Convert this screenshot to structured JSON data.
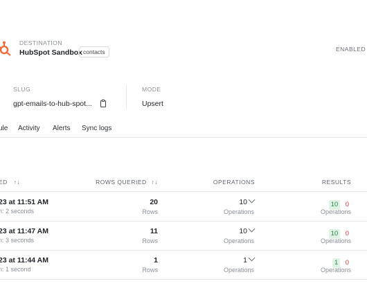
{
  "destination": {
    "section_label": "DESTINATION",
    "name": "HubSpot Sandbox",
    "object_tag": "contacts",
    "status": "ENABLED"
  },
  "details": {
    "slug_label": "SLUG",
    "slug_value": "gpt-emails-to-hub-spot...",
    "mode_label": "MODE",
    "mode_value": "Upsert"
  },
  "tabs": [
    {
      "label": "ule"
    },
    {
      "label": "Activity"
    },
    {
      "label": "Alerts"
    },
    {
      "label": "Sync logs"
    }
  ],
  "table": {
    "headers": {
      "started": "ED",
      "started_sort": "↑↓",
      "rows_queried": "ROWS QUERIED",
      "rows_sort": "↑↓",
      "operations": "OPERATIONS",
      "results": "RESULTS"
    },
    "rows": [
      {
        "time": "23 at 11:51 AM",
        "duration": "n: 2 seconds",
        "rows": "20",
        "rows_unit": "Rows",
        "ops": "10",
        "ops_unit": "Operations",
        "success": "10",
        "fail": "0",
        "results_unit": "Operations"
      },
      {
        "time": "23 at 11:47 AM",
        "duration": "n: 3 seconds",
        "rows": "11",
        "rows_unit": "Rows",
        "ops": "10",
        "ops_unit": "Operations",
        "success": "10",
        "fail": "0",
        "results_unit": "Operations"
      },
      {
        "time": "23 at 11:44 AM",
        "duration": "n: 1 second",
        "rows": "1",
        "rows_unit": "Rows",
        "ops": "1",
        "ops_unit": "Operations",
        "success": "1",
        "fail": "0",
        "results_unit": "Operations"
      }
    ]
  },
  "colors": {
    "hubspot_orange": "#f26b3a",
    "success_green": "#2f8a4a",
    "fail_red": "#d23c3c"
  },
  "icons": [
    "hubspot-logo-icon",
    "copy-icon",
    "sort-icon",
    "chevron-down-icon"
  ]
}
